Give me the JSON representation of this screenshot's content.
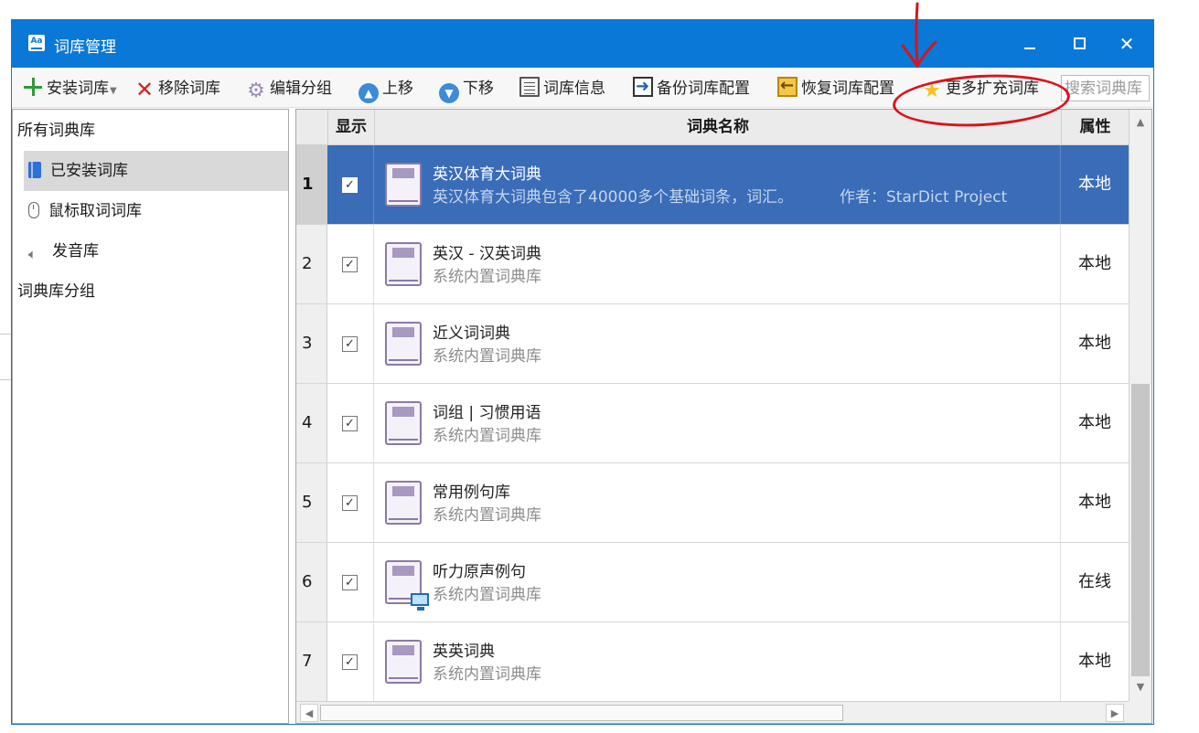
{
  "window": {
    "title": "词库管理"
  },
  "toolbar": {
    "install": "安装词库",
    "remove": "移除词库",
    "edit_group": "编辑分组",
    "move_up": "上移",
    "move_down": "下移",
    "info": "词库信息",
    "backup": "备份词库配置",
    "restore": "恢复词库配置",
    "more": "更多扩充词库",
    "search_placeholder": "搜索词典库"
  },
  "sidebar": {
    "all_title": "所有词典库",
    "items": [
      {
        "label": "已安装词库",
        "icon": "book-icon"
      },
      {
        "label": "鼠标取词词库",
        "icon": "mouse-icon"
      },
      {
        "label": "发音库",
        "icon": "speaker-icon"
      }
    ],
    "group_title": "词典库分组"
  },
  "table": {
    "headers": {
      "show": "显示",
      "name": "词典名称",
      "attr": "属性"
    },
    "rows": [
      {
        "num": "1",
        "name": "英汉体育大词典",
        "desc": "英汉体育大词典包含了40000多个基础词条，词汇。",
        "author": "作者：StarDict Project",
        "attr": "本地",
        "checked": "✓"
      },
      {
        "num": "2",
        "name": "英汉 - 汉英词典",
        "desc": "系统内置词典库",
        "attr": "本地",
        "checked": "✓"
      },
      {
        "num": "3",
        "name": "近义词词典",
        "desc": "系统内置词典库",
        "attr": "本地",
        "checked": "✓"
      },
      {
        "num": "4",
        "name": "词组 | 习惯用语",
        "desc": "系统内置词典库",
        "attr": "本地",
        "checked": "✓"
      },
      {
        "num": "5",
        "name": "常用例句库",
        "desc": "系统内置词典库",
        "attr": "本地",
        "checked": "✓"
      },
      {
        "num": "6",
        "name": "听力原声例句",
        "desc": "系统内置词典库",
        "attr": "在线",
        "checked": "✓"
      },
      {
        "num": "7",
        "name": "英英词典",
        "desc": "系统内置词典库",
        "attr": "本地",
        "checked": "✓"
      }
    ]
  },
  "colors": {
    "titlebar": "#0a78d7",
    "selected_row": "#3a6cb8",
    "annotation": "#d8141b"
  }
}
